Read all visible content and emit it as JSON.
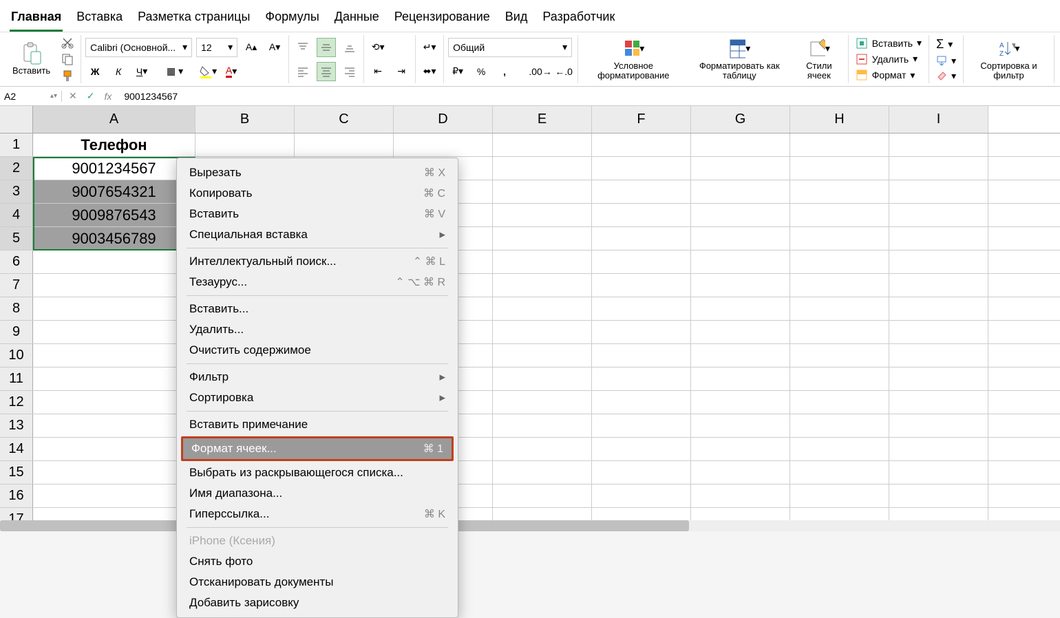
{
  "tabs": [
    "Главная",
    "Вставка",
    "Разметка страницы",
    "Формулы",
    "Данные",
    "Рецензирование",
    "Вид",
    "Разработчик"
  ],
  "ribbon": {
    "paste": "Вставить",
    "font_name": "Calibri (Основной...",
    "font_size": "12",
    "number_format": "Общий",
    "cond_fmt": "Условное форматирование",
    "fmt_table": "Форматировать как таблицу",
    "cell_styles": "Стили ячеек",
    "insert": "Вставить",
    "delete": "Удалить",
    "format": "Формат",
    "sort_filter": "Сортировка и фильтр"
  },
  "namebox": "A2",
  "formula": "9001234567",
  "columns": [
    "A",
    "B",
    "C",
    "D",
    "E",
    "F",
    "G",
    "H",
    "I"
  ],
  "rows": [
    "1",
    "2",
    "3",
    "4",
    "5",
    "6",
    "7",
    "8",
    "9",
    "10",
    "11",
    "12",
    "13",
    "14",
    "15",
    "16",
    "17"
  ],
  "cells": {
    "A1": "Телефон",
    "A2": "9001234567",
    "A3": "9007654321",
    "A4": "9009876543",
    "A5": "9003456789"
  },
  "ctx": {
    "cut": "Вырезать",
    "cut_sc": "⌘ X",
    "copy": "Копировать",
    "copy_sc": "⌘ C",
    "paste": "Вставить",
    "paste_sc": "⌘ V",
    "pspecial": "Специальная вставка",
    "lookup": "Интеллектуальный поиск...",
    "lookup_sc": "⌃ ⌘ L",
    "thesaurus": "Тезаурус...",
    "thesaurus_sc": "⌃ ⌥ ⌘ R",
    "insert": "Вставить...",
    "delete": "Удалить...",
    "clear": "Очистить содержимое",
    "filter": "Фильтр",
    "sort": "Сортировка",
    "comment": "Вставить примечание",
    "fmtcells": "Формат ячеек...",
    "fmtcells_sc": "⌘ 1",
    "dropdown": "Выбрать из раскрывающегося списка...",
    "range": "Имя диапазона...",
    "hyperlink": "Гиперссылка...",
    "hyperlink_sc": "⌘ K",
    "iphone": "iPhone (Ксения)",
    "photo": "Снять фото",
    "scan": "Отсканировать документы",
    "sketch": "Добавить зарисовку"
  }
}
